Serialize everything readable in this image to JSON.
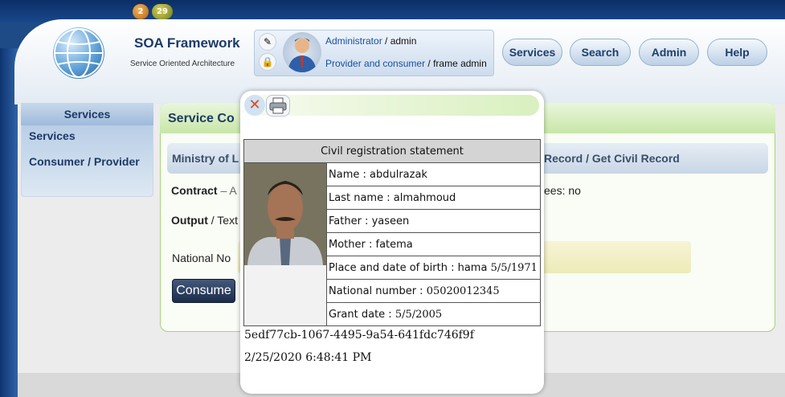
{
  "header": {
    "badges": [
      "2",
      "29"
    ],
    "app_title": "SOA Framework",
    "app_subtitle": "Service Oriented Architecture",
    "user": {
      "role_link": "Administrator",
      "role_sep": " / ",
      "role_value": "admin",
      "type_link": "Provider and consumer",
      "type_sep": " / ",
      "type_value": "frame admin"
    },
    "nav": [
      "Services",
      "Search",
      "Admin",
      "Help"
    ]
  },
  "sidebar": {
    "title": "Services",
    "items": [
      {
        "label": "Services"
      },
      {
        "label": "Consumer / Provider"
      }
    ]
  },
  "panel": {
    "title": "Service Co",
    "crumb_left": "Ministry of L",
    "crumb_right": "Record / Get Civil Record",
    "contract_label": "Contract",
    "contract_value": " – A",
    "fees_text": "ees: no",
    "output_label": "Output",
    "output_value": " / Text",
    "national_label": "National No",
    "consume_label": "Consume"
  },
  "modal": {
    "close_icon": "close-icon",
    "print_icon": "printer-icon",
    "table_title": "Civil registration statement",
    "rows": [
      {
        "label": "Name : ",
        "value": "abdulrazak",
        "numeric": false
      },
      {
        "label": "Last name : ",
        "value": "almahmoud",
        "numeric": false
      },
      {
        "label": "Father : ",
        "value": "yaseen",
        "numeric": false
      },
      {
        "label": "Mother : ",
        "value": "fatema",
        "numeric": false
      },
      {
        "label": "Place and date of birth : ",
        "value": "hama",
        "extra": " 5/5/1971"
      },
      {
        "label": "National number : ",
        "value": "05020012345",
        "numeric": true
      },
      {
        "label": "Grant date : ",
        "value": "5/5/2005",
        "numeric": true
      }
    ],
    "guid": "5edf77cb-1067-4495-9a54-641fdc746f9f",
    "timestamp": "2/25/2020 6:48:41 PM"
  },
  "colors": {
    "brand_blue": "#1e4a86",
    "title_navy": "#1d3a66",
    "panel_green": "#a6d27c",
    "close_red": "#e4461f"
  }
}
